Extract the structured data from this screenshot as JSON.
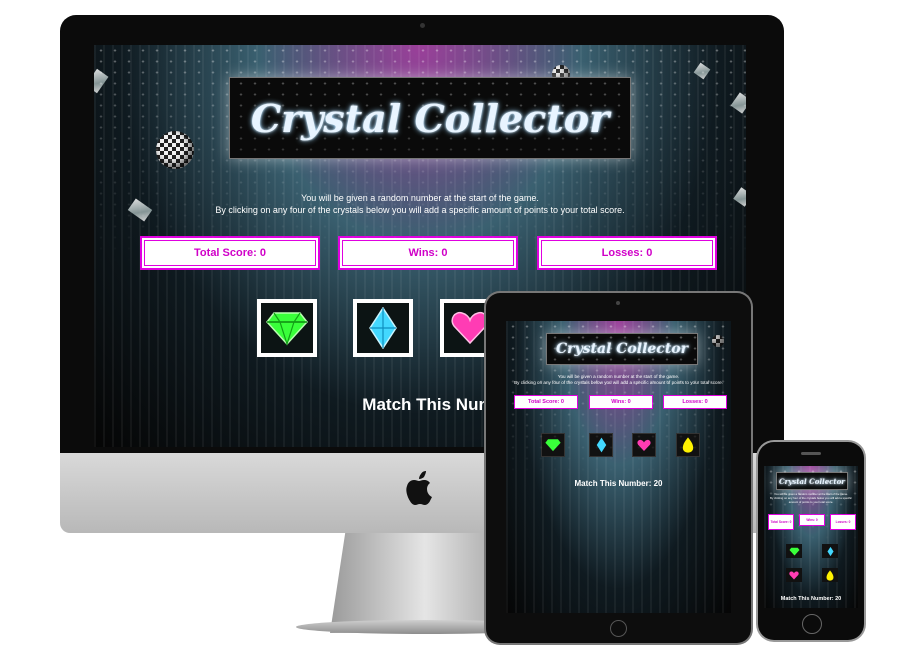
{
  "game": {
    "title": "Crystal Collector",
    "intro_line1": "You will be given a random number at the start of the game.",
    "intro_line2": "By clicking on any four of the crystals below you will add a specific amount of points to your total score.",
    "total_score": "Total Score: 0",
    "wins": "Wins: 0",
    "losses": "Losses: 0",
    "match_label": "Match This Number:",
    "match_full": "Match This Number: 20",
    "crystals": [
      {
        "name": "green-gem",
        "color": "#39ff3a"
      },
      {
        "name": "blue-gem",
        "color": "#43d8ff"
      },
      {
        "name": "pink-gem",
        "color": "#ff3cb4"
      },
      {
        "name": "yellow-gem",
        "color": "#fff200"
      }
    ]
  },
  "colors": {
    "accent": "#e000e0",
    "stat_text": "#d000c8"
  },
  "devices": [
    "imac",
    "ipad",
    "iphone"
  ]
}
